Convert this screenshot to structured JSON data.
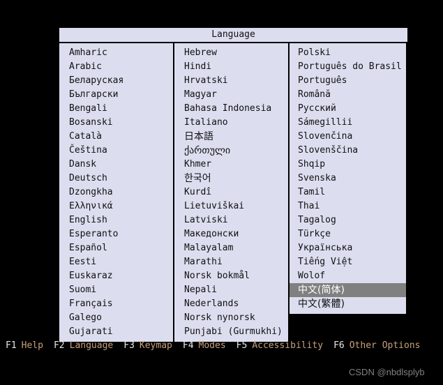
{
  "dialog": {
    "title": "Language",
    "columns": [
      {
        "id": "column-1",
        "items": [
          {
            "label": "Amharic",
            "script": "latin",
            "selected": false
          },
          {
            "label": "Arabic",
            "script": "latin",
            "selected": false
          },
          {
            "label": "Беларуская",
            "script": "latin",
            "selected": false
          },
          {
            "label": "Български",
            "script": "latin",
            "selected": false
          },
          {
            "label": "Bengali",
            "script": "latin",
            "selected": false
          },
          {
            "label": "Bosanski",
            "script": "latin",
            "selected": false
          },
          {
            "label": "Català",
            "script": "latin",
            "selected": false
          },
          {
            "label": "Čeština",
            "script": "latin",
            "selected": false
          },
          {
            "label": "Dansk",
            "script": "latin",
            "selected": false
          },
          {
            "label": "Deutsch",
            "script": "latin",
            "selected": false
          },
          {
            "label": "Dzongkha",
            "script": "latin",
            "selected": false
          },
          {
            "label": "Ελληνικά",
            "script": "latin",
            "selected": false
          },
          {
            "label": "English",
            "script": "latin",
            "selected": false
          },
          {
            "label": "Esperanto",
            "script": "latin",
            "selected": false
          },
          {
            "label": "Español",
            "script": "latin",
            "selected": false
          },
          {
            "label": "Eesti",
            "script": "latin",
            "selected": false
          },
          {
            "label": "Euskaraz",
            "script": "latin",
            "selected": false
          },
          {
            "label": "Suomi",
            "script": "latin",
            "selected": false
          },
          {
            "label": "Français",
            "script": "latin",
            "selected": false
          },
          {
            "label": "Galego",
            "script": "latin",
            "selected": false
          },
          {
            "label": "Gujarati",
            "script": "latin",
            "selected": false
          }
        ]
      },
      {
        "id": "column-2",
        "items": [
          {
            "label": "Hebrew",
            "script": "latin",
            "selected": false
          },
          {
            "label": "Hindi",
            "script": "latin",
            "selected": false
          },
          {
            "label": "Hrvatski",
            "script": "latin",
            "selected": false
          },
          {
            "label": "Magyar",
            "script": "latin",
            "selected": false
          },
          {
            "label": "Bahasa Indonesia",
            "script": "latin",
            "selected": false
          },
          {
            "label": "Italiano",
            "script": "latin",
            "selected": false
          },
          {
            "label": "日本語",
            "script": "cjk",
            "selected": false
          },
          {
            "label": "ქართული",
            "script": "cjk",
            "selected": false
          },
          {
            "label": "Khmer",
            "script": "latin",
            "selected": false
          },
          {
            "label": "한국어",
            "script": "cjk",
            "selected": false
          },
          {
            "label": "Kurdî",
            "script": "latin",
            "selected": false
          },
          {
            "label": "Lietuviškai",
            "script": "latin",
            "selected": false
          },
          {
            "label": "Latviski",
            "script": "latin",
            "selected": false
          },
          {
            "label": "Македонски",
            "script": "latin",
            "selected": false
          },
          {
            "label": "Malayalam",
            "script": "latin",
            "selected": false
          },
          {
            "label": "Marathi",
            "script": "latin",
            "selected": false
          },
          {
            "label": "Norsk bokmål",
            "script": "latin",
            "selected": false
          },
          {
            "label": "Nepali",
            "script": "latin",
            "selected": false
          },
          {
            "label": "Nederlands",
            "script": "latin",
            "selected": false
          },
          {
            "label": "Norsk nynorsk",
            "script": "latin",
            "selected": false
          },
          {
            "label": "Punjabi (Gurmukhi)",
            "script": "latin",
            "selected": false
          }
        ]
      },
      {
        "id": "column-3",
        "items": [
          {
            "label": "Polski",
            "script": "latin",
            "selected": false
          },
          {
            "label": "Português do Brasil",
            "script": "latin",
            "selected": false
          },
          {
            "label": "Português",
            "script": "latin",
            "selected": false
          },
          {
            "label": "Română",
            "script": "latin",
            "selected": false
          },
          {
            "label": "Русский",
            "script": "latin",
            "selected": false
          },
          {
            "label": "Sámegillii",
            "script": "latin",
            "selected": false
          },
          {
            "label": "Slovenčina",
            "script": "latin",
            "selected": false
          },
          {
            "label": "Slovenščina",
            "script": "latin",
            "selected": false
          },
          {
            "label": "Shqip",
            "script": "latin",
            "selected": false
          },
          {
            "label": "Svenska",
            "script": "latin",
            "selected": false
          },
          {
            "label": "Tamil",
            "script": "latin",
            "selected": false
          },
          {
            "label": "Thai",
            "script": "latin",
            "selected": false
          },
          {
            "label": "Tagalog",
            "script": "latin",
            "selected": false
          },
          {
            "label": "Türkçe",
            "script": "latin",
            "selected": false
          },
          {
            "label": "Українська",
            "script": "latin",
            "selected": false
          },
          {
            "label": "Tiếng Việt",
            "script": "latin",
            "selected": false
          },
          {
            "label": "Wolof",
            "script": "latin",
            "selected": false
          },
          {
            "label": "中文(简体)",
            "script": "cjk",
            "selected": true
          },
          {
            "label": "中文(繁體)",
            "script": "cjk",
            "selected": false
          }
        ]
      }
    ]
  },
  "function_keys": [
    {
      "key": "F1",
      "label": "Help"
    },
    {
      "key": "F2",
      "label": "Language"
    },
    {
      "key": "F3",
      "label": "Keymap"
    },
    {
      "key": "F4",
      "label": "Modes"
    },
    {
      "key": "F5",
      "label": "Accessibility"
    },
    {
      "key": "F6",
      "label": "Other Options"
    }
  ],
  "watermark": "CSDN @nbdlsplyb",
  "colors": {
    "panel_background": "#dcdef0",
    "screen_background": "#000000",
    "selection_background": "#808080",
    "selection_text": "#ffffff",
    "fkey_key_text": "#e8e8e8",
    "fkey_label_text": "#c8a07a",
    "watermark_text": "#808080"
  }
}
